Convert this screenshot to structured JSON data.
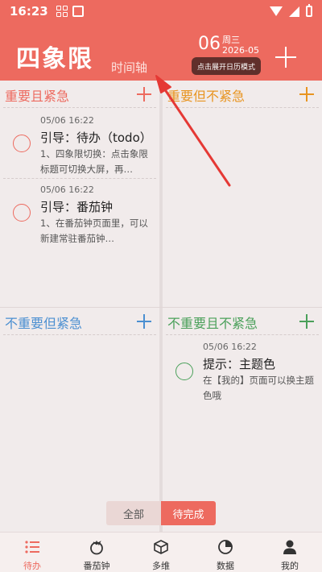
{
  "status_bar": {
    "time": "16:23"
  },
  "header": {
    "title": "四象限",
    "timeline_link": "时间轴",
    "date_day": "06",
    "date_weekday": "周三",
    "date_year_month": "2026-05",
    "calendar_mode_button": "点击展开日历模式"
  },
  "quadrants": [
    {
      "title": "重要且紧急",
      "color": "#ed6a5f",
      "tasks": [
        {
          "time": "05/06 16:22",
          "title": "引导：待办（todo）",
          "desc": "1、四象限切换：点击象限标题可切换大屏，再…"
        },
        {
          "time": "05/06 16:22",
          "title": "引导：番茄钟",
          "desc": "1、在番茄钟页面里，可以新建常驻番茄钟…"
        }
      ]
    },
    {
      "title": "重要但不紧急",
      "color": "#e89420",
      "tasks": []
    },
    {
      "title": "不重要但紧急",
      "color": "#4b8fd1",
      "tasks": []
    },
    {
      "title": "不重要且不紧急",
      "color": "#4aa05a",
      "tasks": [
        {
          "time": "05/06 16:22",
          "title": "提示：主题色",
          "desc": "在【我的】页面可以换主题色哦"
        }
      ]
    }
  ],
  "filter": {
    "all_label": "全部",
    "pending_label": "待完成",
    "selected": "待完成"
  },
  "bottom_nav": [
    {
      "label": "待办",
      "icon": "list-icon",
      "active": true
    },
    {
      "label": "番茄钟",
      "icon": "tomato-icon",
      "active": false
    },
    {
      "label": "多维",
      "icon": "cube-icon",
      "active": false
    },
    {
      "label": "数据",
      "icon": "pie-chart-icon",
      "active": false
    },
    {
      "label": "我的",
      "icon": "person-icon",
      "active": false
    }
  ],
  "colors": {
    "accent": "#ed6a5f",
    "background": "#f1ebeb",
    "annotation_arrow": "#e53935"
  }
}
